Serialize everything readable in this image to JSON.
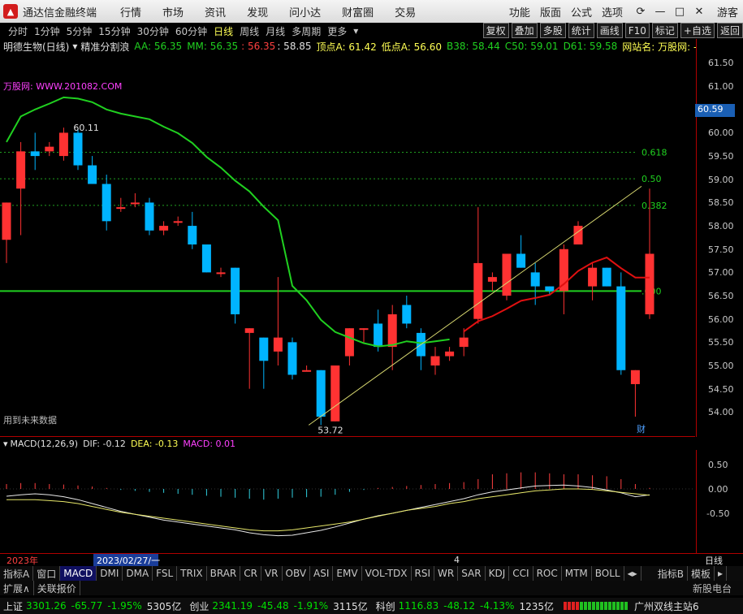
{
  "titlebar": {
    "app_name": "通达信金融终端",
    "menus": [
      "行情",
      "市场",
      "资讯",
      "发现",
      "问小达",
      "财富圈",
      "交易"
    ],
    "right_menus": [
      "功能",
      "版面",
      "公式",
      "选项"
    ],
    "user": "游客"
  },
  "periods": {
    "items": [
      "分时",
      "1分钟",
      "5分钟",
      "15分钟",
      "30分钟",
      "60分钟",
      "日线",
      "周线",
      "月线",
      "多周期",
      "更多"
    ],
    "active": "日线",
    "right_buttons": [
      "复权",
      "叠加",
      "多股",
      "统计",
      "画线",
      "F10",
      "标记",
      "+自选",
      "返回"
    ]
  },
  "infobar": {
    "stock": "明德生物(日线)",
    "indicator": "精准分割浪",
    "aa": "AA: 56.35",
    "mm": "MM: 56.35",
    "v1": ": 56.35",
    "v2": ": 58.85",
    "top": "顶点A: 61.42",
    "low": "低点A: 56.60",
    "b38": "B38: 58.44",
    "c50": "C50: 59.01",
    "d61": "D61: 59.58",
    "site": "网站名: 万股网: -"
  },
  "chart": {
    "site_label": "万股网: WWW.201082.COM",
    "future_label": "用到未来数据",
    "high_label": "60.11",
    "low_label": "53.72",
    "fib_labels": [
      "0.618",
      "0.50",
      "0.382",
      ".000"
    ],
    "cai": "财",
    "current_price": "60.59",
    "yticks": [
      "61.50",
      "61.00",
      "60.50",
      "60.00",
      "59.50",
      "59.00",
      "58.50",
      "58.00",
      "57.50",
      "57.00",
      "56.50",
      "56.00",
      "55.50",
      "55.00",
      "54.50",
      "54.00"
    ],
    "colors": {
      "up": "#ff3232",
      "down": "#00b4ff",
      "ma": "#20d020",
      "ma2": "#e01010",
      "fib": "#20a020",
      "trend": "#d8d870"
    }
  },
  "chart_data": {
    "type": "candlestick",
    "ylim": [
      53.5,
      61.7
    ],
    "candles": [
      {
        "o": 57.7,
        "h": 58.5,
        "l": 57.2,
        "c": 58.5
      },
      {
        "o": 58.8,
        "h": 59.8,
        "l": 57.8,
        "c": 59.6
      },
      {
        "o": 59.6,
        "h": 60.0,
        "l": 59.2,
        "c": 59.5
      },
      {
        "o": 59.6,
        "h": 59.8,
        "l": 59.5,
        "c": 59.7
      },
      {
        "o": 59.5,
        "h": 60.11,
        "l": 59.4,
        "c": 60.0
      },
      {
        "o": 60.0,
        "h": 60.1,
        "l": 59.2,
        "c": 59.3
      },
      {
        "o": 59.3,
        "h": 59.5,
        "l": 58.9,
        "c": 58.9
      },
      {
        "o": 58.9,
        "h": 59.1,
        "l": 57.9,
        "c": 58.1
      },
      {
        "o": 58.4,
        "h": 58.6,
        "l": 58.3,
        "c": 58.4
      },
      {
        "o": 58.5,
        "h": 58.7,
        "l": 58.4,
        "c": 58.5
      },
      {
        "o": 58.5,
        "h": 58.6,
        "l": 57.8,
        "c": 57.9
      },
      {
        "o": 57.9,
        "h": 58.1,
        "l": 57.8,
        "c": 58.0
      },
      {
        "o": 58.1,
        "h": 58.2,
        "l": 58.0,
        "c": 58.1
      },
      {
        "o": 58.0,
        "h": 58.3,
        "l": 57.5,
        "c": 57.6
      },
      {
        "o": 57.6,
        "h": 57.6,
        "l": 57.0,
        "c": 57.0
      },
      {
        "o": 57.0,
        "h": 57.1,
        "l": 56.9,
        "c": 57.0
      },
      {
        "o": 57.1,
        "h": 57.1,
        "l": 55.9,
        "c": 56.1
      },
      {
        "o": 55.7,
        "h": 55.8,
        "l": 54.5,
        "c": 55.8
      },
      {
        "o": 55.6,
        "h": 55.6,
        "l": 54.5,
        "c": 55.1
      },
      {
        "o": 55.3,
        "h": 56.9,
        "l": 55.0,
        "c": 55.6
      },
      {
        "o": 55.5,
        "h": 55.6,
        "l": 54.7,
        "c": 54.8
      },
      {
        "o": 54.9,
        "h": 55.0,
        "l": 54.9,
        "c": 54.9
      },
      {
        "o": 54.9,
        "h": 54.9,
        "l": 53.72,
        "c": 53.9
      },
      {
        "o": 53.8,
        "h": 55.0,
        "l": 53.8,
        "c": 55.0
      },
      {
        "o": 55.2,
        "h": 55.8,
        "l": 55.0,
        "c": 55.8
      },
      {
        "o": 55.8,
        "h": 55.8,
        "l": 55.5,
        "c": 55.8
      },
      {
        "o": 55.9,
        "h": 56.2,
        "l": 55.3,
        "c": 55.4
      },
      {
        "o": 55.4,
        "h": 56.3,
        "l": 54.9,
        "c": 56.1
      },
      {
        "o": 56.3,
        "h": 56.5,
        "l": 55.8,
        "c": 55.9
      },
      {
        "o": 55.7,
        "h": 55.8,
        "l": 54.9,
        "c": 55.2
      },
      {
        "o": 55.0,
        "h": 55.4,
        "l": 54.8,
        "c": 55.2
      },
      {
        "o": 55.2,
        "h": 55.4,
        "l": 55.1,
        "c": 55.3
      },
      {
        "o": 55.4,
        "h": 55.8,
        "l": 55.2,
        "c": 55.6
      },
      {
        "o": 56.0,
        "h": 58.4,
        "l": 55.9,
        "c": 57.2
      },
      {
        "o": 56.8,
        "h": 57.0,
        "l": 56.6,
        "c": 56.9
      },
      {
        "o": 56.5,
        "h": 57.4,
        "l": 56.4,
        "c": 57.4
      },
      {
        "o": 57.4,
        "h": 57.8,
        "l": 57.1,
        "c": 57.1
      },
      {
        "o": 57.0,
        "h": 57.2,
        "l": 56.3,
        "c": 56.7
      },
      {
        "o": 56.7,
        "h": 56.7,
        "l": 56.5,
        "c": 56.6
      },
      {
        "o": 56.6,
        "h": 57.6,
        "l": 56.1,
        "c": 57.5
      },
      {
        "o": 57.6,
        "h": 58.1,
        "l": 57.6,
        "c": 58.0
      },
      {
        "o": 56.7,
        "h": 57.2,
        "l": 56.4,
        "c": 57.1
      },
      {
        "o": 57.1,
        "h": 57.1,
        "l": 56.7,
        "c": 56.7
      },
      {
        "o": 56.7,
        "h": 57.0,
        "l": 54.8,
        "c": 54.9
      },
      {
        "o": 54.6,
        "h": 54.9,
        "l": 53.9,
        "c": 54.9
      },
      {
        "o": 56.1,
        "h": 58.8,
        "l": 56.0,
        "c": 57.4
      }
    ],
    "fib_levels": [
      {
        "label": "0.618",
        "y": 59.58
      },
      {
        "label": "0.50",
        "y": 59.01
      },
      {
        "label": "0.382",
        "y": 58.44
      },
      {
        "label": ".000",
        "y": 56.6
      }
    ]
  },
  "macd": {
    "label": "MACD(12,26,9)",
    "dif": "DIF: -0.12",
    "dea": "DEA: -0.13",
    "macd": "MACD: 0.01",
    "yticks": [
      "0.50",
      "0.00",
      "-0.50"
    ]
  },
  "datebar": {
    "year": "2023年",
    "date": "2023/02/27/一",
    "mark": "4",
    "period": "日线"
  },
  "tabs": {
    "items": [
      "指标A",
      "窗口",
      "MACD",
      "DMI",
      "DMA",
      "FSL",
      "TRIX",
      "BRAR",
      "CR",
      "VR",
      "OBV",
      "ASI",
      "EMV",
      "VOL-TDX",
      "RSI",
      "WR",
      "SAR",
      "KDJ",
      "CCI",
      "ROC",
      "MTM",
      "BOLL"
    ],
    "active": "MACD",
    "right": [
      "指标B",
      "模板"
    ]
  },
  "bottom": {
    "items": [
      "扩展∧",
      "关联报价"
    ],
    "brand": "新股电台"
  },
  "status": {
    "sh_label": "上证",
    "sh_val": "3301.26",
    "sh_chg": "-65.77",
    "sh_pct": "-1.95%",
    "sh_amt": "5305亿",
    "cy_label": "创业",
    "cy_val": "2341.19",
    "cy_chg": "-45.48",
    "cy_pct": "-1.91%",
    "cy_amt": "3115亿",
    "kc_label": "科创",
    "kc_val": "1116.83",
    "kc_chg": "-48.12",
    "kc_pct": "-4.13%",
    "kc_amt": "1235亿",
    "server": "广州双线主站6"
  }
}
